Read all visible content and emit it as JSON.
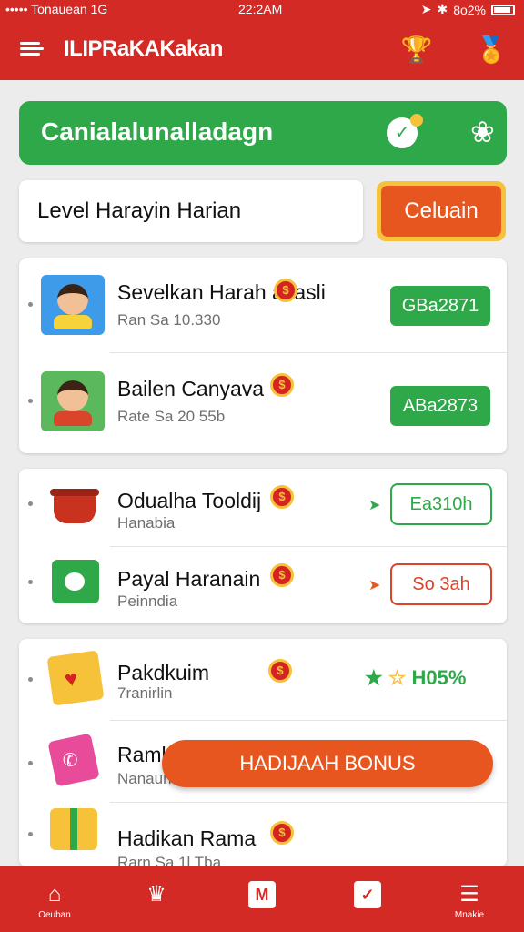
{
  "status_bar": {
    "carrier": "••••• Tonauean 1G",
    "time": "22:2AM",
    "battery": "8o2%"
  },
  "app_bar": {
    "title": "ILIPRaKAKakan"
  },
  "banner": {
    "title": "Canialalunalladagn"
  },
  "level": {
    "label": "Level Harayin Harian",
    "button_label": "Celuain"
  },
  "group1": [
    {
      "name": "Sevelkan Harah akasli",
      "sub": "Ran Sa 10.330",
      "value": "GBa2871"
    },
    {
      "name": "Bailen Canyava",
      "sub": "Rate Sa 20 55b",
      "value": "ABa2873"
    }
  ],
  "group2": [
    {
      "name": "Odualha Tooldij",
      "sub": "Hanabia",
      "value": "Ea310h",
      "accent": "#2fa84a"
    },
    {
      "name": "Payal Haranain",
      "sub": "Peinndia",
      "value": "So 3ah",
      "accent": "#d9442b"
    }
  ],
  "group3": [
    {
      "name": "Pakdkuim",
      "sub": "7ranirlin",
      "value": "H05%"
    },
    {
      "name": "Ramb",
      "sub": "Nanaun"
    },
    {
      "name": "Hadikan Rama",
      "sub": "Rarn Sa 1l Tba"
    }
  ],
  "bonus_button": {
    "label": "HADIJAAH BONUS"
  },
  "bottom_nav": [
    {
      "label": "Oeuban"
    },
    {
      "label": ""
    },
    {
      "label": ""
    },
    {
      "label": ""
    },
    {
      "label": "Mnakie"
    }
  ],
  "colors": {
    "brand_red": "#d32a26",
    "green": "#2fa84a",
    "orange": "#e8561f",
    "gold": "#f6c23a"
  }
}
